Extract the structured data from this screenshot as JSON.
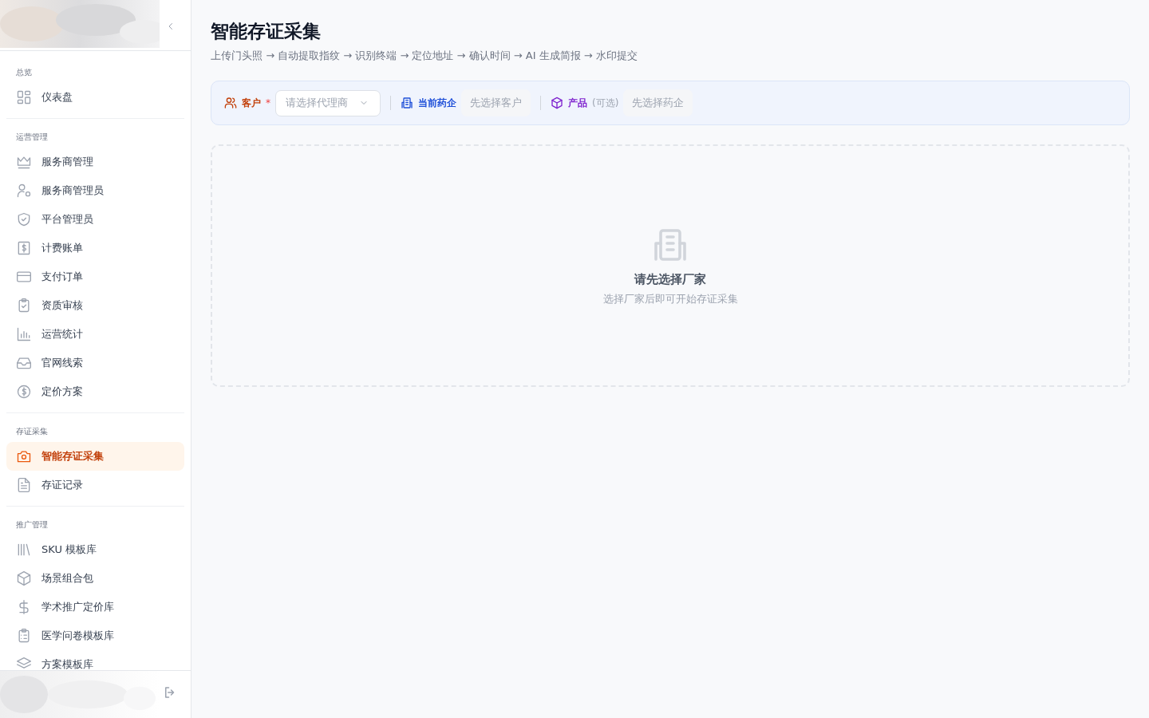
{
  "sidebar": {
    "groups": [
      {
        "label": "总览",
        "items": [
          {
            "label": "仪表盘",
            "selected": false
          }
        ]
      },
      {
        "label": "运营管理",
        "items": [
          {
            "label": "服务商管理",
            "selected": false
          },
          {
            "label": "服务商管理员",
            "selected": false
          },
          {
            "label": "平台管理员",
            "selected": false
          },
          {
            "label": "计费账单",
            "selected": false
          },
          {
            "label": "支付订单",
            "selected": false
          },
          {
            "label": "资质审核",
            "selected": false
          },
          {
            "label": "运营统计",
            "selected": false
          },
          {
            "label": "官网线索",
            "selected": false
          },
          {
            "label": "定价方案",
            "selected": false
          }
        ]
      },
      {
        "label": "存证采集",
        "items": [
          {
            "label": "智能存证采集",
            "selected": true
          },
          {
            "label": "存证记录",
            "selected": false
          }
        ]
      },
      {
        "label": "推广管理",
        "items": [
          {
            "label": "SKU 模板库",
            "selected": false
          },
          {
            "label": "场景组合包",
            "selected": false
          },
          {
            "label": "学术推广定价库",
            "selected": false
          },
          {
            "label": "医学问卷模板库",
            "selected": false
          },
          {
            "label": "方案模板库",
            "selected": false
          }
        ]
      }
    ]
  },
  "page": {
    "title": "智能存证采集",
    "subtitle": "上传门头照 → 自动提取指纹 → 识别终端 → 定位地址 → 确认时间 → AI 生成简报 → 水印提交"
  },
  "filters": {
    "customer": {
      "label": "客户",
      "required_mark": "*",
      "placeholder": "请选择代理商"
    },
    "company": {
      "label": "当前药企",
      "placeholder": "先选择客户"
    },
    "product": {
      "label": "产品",
      "note": "(可选)",
      "placeholder": "先选择药企"
    }
  },
  "empty": {
    "title": "请先选择厂家",
    "hint": "选择厂家后即可开始存证采集"
  }
}
